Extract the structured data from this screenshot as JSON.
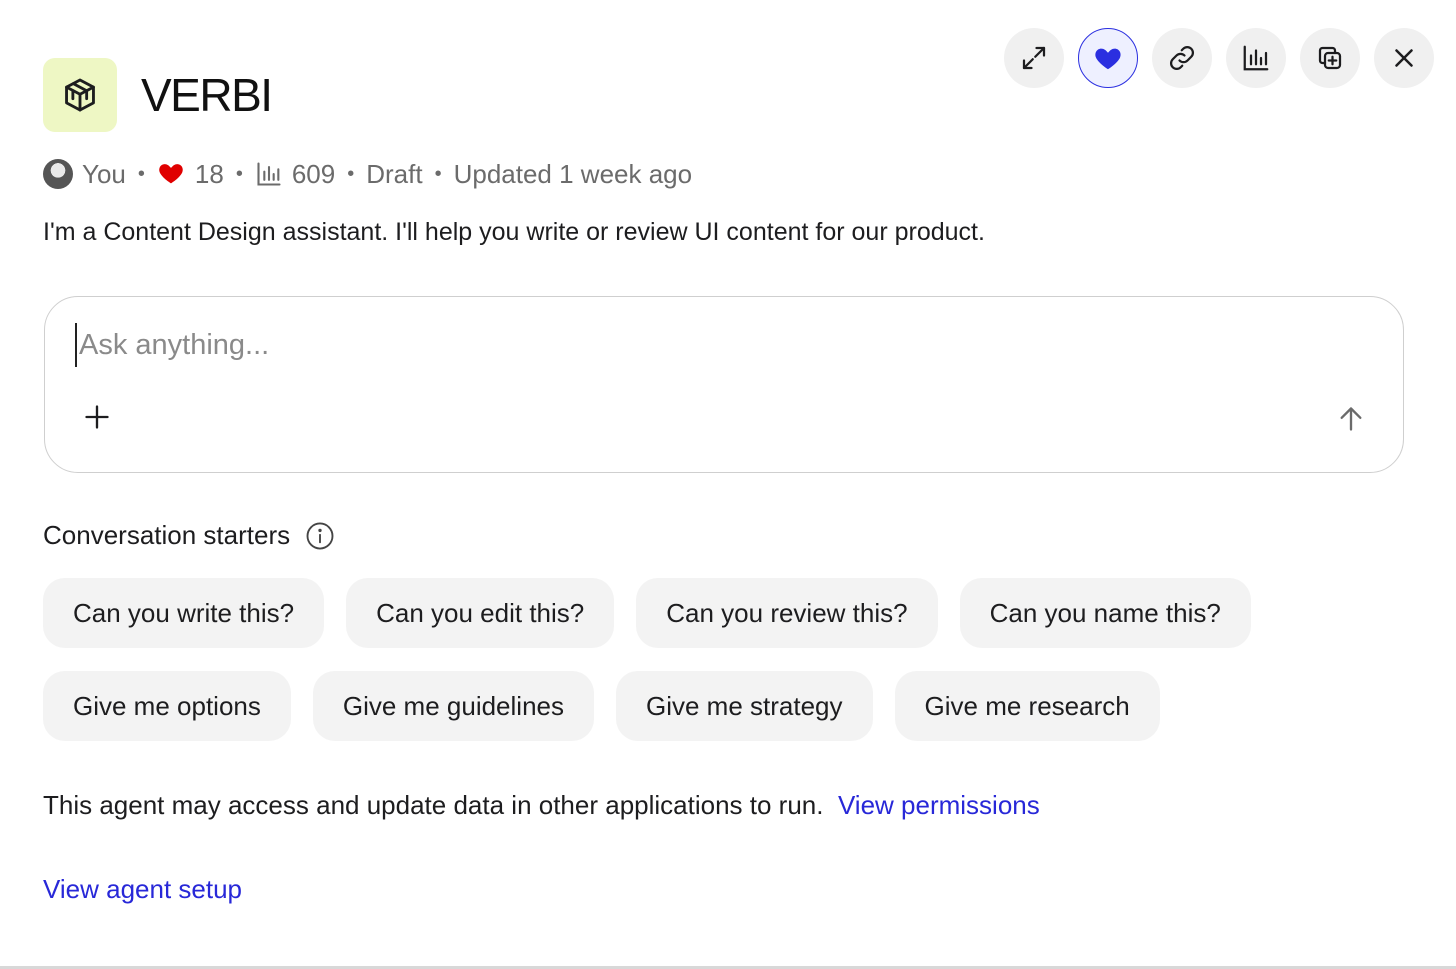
{
  "toolbar": {
    "items": [
      {
        "icon": "expand-icon"
      },
      {
        "icon": "heart-icon",
        "active": true,
        "active_color": "#2b2fe0"
      },
      {
        "icon": "link-icon"
      },
      {
        "icon": "bar-chart-icon"
      },
      {
        "icon": "duplicate-icon"
      },
      {
        "icon": "close-icon"
      }
    ]
  },
  "agent": {
    "name": "VERBI",
    "icon": "cube-icon",
    "icon_bg": "#eef7c4",
    "description": "I'm a Content Design assistant. I'll help you write or review UI content for our product."
  },
  "meta": {
    "owner": "You",
    "likes": "18",
    "likes_color": "#e00000",
    "views": "609",
    "status": "Draft",
    "updated": "Updated 1 week ago",
    "separator": "•"
  },
  "chat": {
    "placeholder": "Ask anything...",
    "value": ""
  },
  "starters": {
    "title": "Conversation starters",
    "row1": [
      "Can you write this?",
      "Can you edit this?",
      "Can you review this?",
      "Can you name this?"
    ],
    "row2": [
      "Give me options",
      "Give me guidelines",
      "Give me strategy",
      "Give me research"
    ]
  },
  "footer": {
    "permissions_text": "This agent may access and update data in other applications to run.",
    "permissions_link": "View permissions",
    "setup_link": "View agent setup",
    "link_color": "#2828d8"
  }
}
